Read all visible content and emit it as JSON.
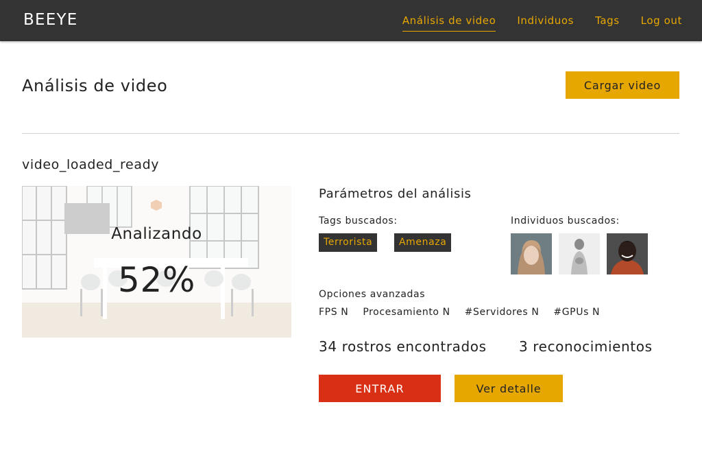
{
  "header": {
    "brand": "BEEYE",
    "nav": [
      {
        "label": "Análisis de video",
        "active": true
      },
      {
        "label": "Individuos",
        "active": false
      },
      {
        "label": "Tags",
        "active": false
      },
      {
        "label": "Log out",
        "active": false
      }
    ]
  },
  "page": {
    "title": "Análisis de video",
    "upload_button": "Cargar video"
  },
  "video": {
    "name": "video_loaded_ready",
    "status": "Analizando",
    "progress": "52%"
  },
  "params": {
    "title": "Parámetros del análisis",
    "tags_label": "Tags buscados:",
    "tags": [
      "Terrorista",
      "Amenaza"
    ],
    "individuals_label": "Individuos buscados:",
    "advanced_label": "Opciones avanzadas",
    "advanced": [
      "FPS N",
      "Procesamiento N",
      "#Servidores N",
      "#GPUs N"
    ]
  },
  "results": {
    "faces": "34 rostros encontrados",
    "recognitions": "3 reconocimientos"
  },
  "actions": {
    "enter": "ENTRAR",
    "detail": "Ver detalle"
  },
  "colors": {
    "accent": "#e6a800",
    "danger": "#d93015",
    "topbar": "#333333"
  }
}
